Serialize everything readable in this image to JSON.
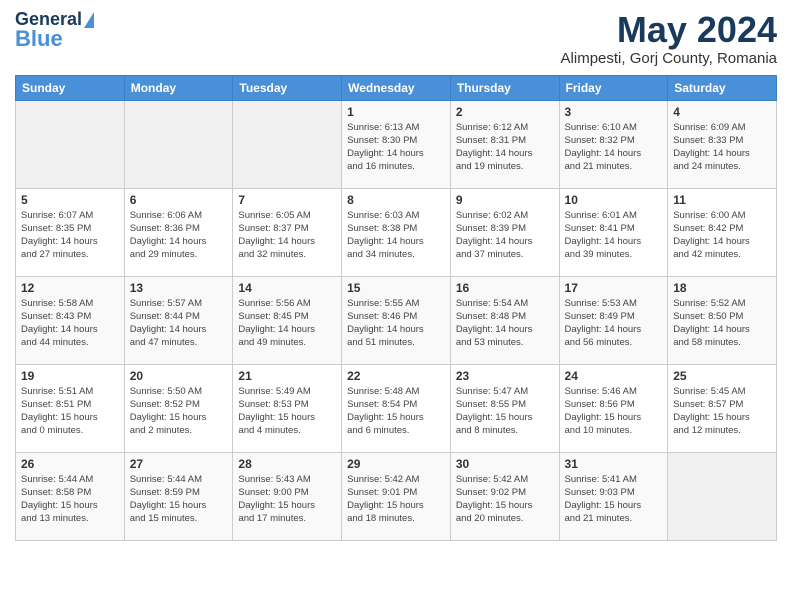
{
  "logo": {
    "line1": "General",
    "line2": "Blue"
  },
  "title": "May 2024",
  "location": "Alimpesti, Gorj County, Romania",
  "days_of_week": [
    "Sunday",
    "Monday",
    "Tuesday",
    "Wednesday",
    "Thursday",
    "Friday",
    "Saturday"
  ],
  "weeks": [
    [
      {
        "day": "",
        "info": ""
      },
      {
        "day": "",
        "info": ""
      },
      {
        "day": "",
        "info": ""
      },
      {
        "day": "1",
        "info": "Sunrise: 6:13 AM\nSunset: 8:30 PM\nDaylight: 14 hours\nand 16 minutes."
      },
      {
        "day": "2",
        "info": "Sunrise: 6:12 AM\nSunset: 8:31 PM\nDaylight: 14 hours\nand 19 minutes."
      },
      {
        "day": "3",
        "info": "Sunrise: 6:10 AM\nSunset: 8:32 PM\nDaylight: 14 hours\nand 21 minutes."
      },
      {
        "day": "4",
        "info": "Sunrise: 6:09 AM\nSunset: 8:33 PM\nDaylight: 14 hours\nand 24 minutes."
      }
    ],
    [
      {
        "day": "5",
        "info": "Sunrise: 6:07 AM\nSunset: 8:35 PM\nDaylight: 14 hours\nand 27 minutes."
      },
      {
        "day": "6",
        "info": "Sunrise: 6:06 AM\nSunset: 8:36 PM\nDaylight: 14 hours\nand 29 minutes."
      },
      {
        "day": "7",
        "info": "Sunrise: 6:05 AM\nSunset: 8:37 PM\nDaylight: 14 hours\nand 32 minutes."
      },
      {
        "day": "8",
        "info": "Sunrise: 6:03 AM\nSunset: 8:38 PM\nDaylight: 14 hours\nand 34 minutes."
      },
      {
        "day": "9",
        "info": "Sunrise: 6:02 AM\nSunset: 8:39 PM\nDaylight: 14 hours\nand 37 minutes."
      },
      {
        "day": "10",
        "info": "Sunrise: 6:01 AM\nSunset: 8:41 PM\nDaylight: 14 hours\nand 39 minutes."
      },
      {
        "day": "11",
        "info": "Sunrise: 6:00 AM\nSunset: 8:42 PM\nDaylight: 14 hours\nand 42 minutes."
      }
    ],
    [
      {
        "day": "12",
        "info": "Sunrise: 5:58 AM\nSunset: 8:43 PM\nDaylight: 14 hours\nand 44 minutes."
      },
      {
        "day": "13",
        "info": "Sunrise: 5:57 AM\nSunset: 8:44 PM\nDaylight: 14 hours\nand 47 minutes."
      },
      {
        "day": "14",
        "info": "Sunrise: 5:56 AM\nSunset: 8:45 PM\nDaylight: 14 hours\nand 49 minutes."
      },
      {
        "day": "15",
        "info": "Sunrise: 5:55 AM\nSunset: 8:46 PM\nDaylight: 14 hours\nand 51 minutes."
      },
      {
        "day": "16",
        "info": "Sunrise: 5:54 AM\nSunset: 8:48 PM\nDaylight: 14 hours\nand 53 minutes."
      },
      {
        "day": "17",
        "info": "Sunrise: 5:53 AM\nSunset: 8:49 PM\nDaylight: 14 hours\nand 56 minutes."
      },
      {
        "day": "18",
        "info": "Sunrise: 5:52 AM\nSunset: 8:50 PM\nDaylight: 14 hours\nand 58 minutes."
      }
    ],
    [
      {
        "day": "19",
        "info": "Sunrise: 5:51 AM\nSunset: 8:51 PM\nDaylight: 15 hours\nand 0 minutes."
      },
      {
        "day": "20",
        "info": "Sunrise: 5:50 AM\nSunset: 8:52 PM\nDaylight: 15 hours\nand 2 minutes."
      },
      {
        "day": "21",
        "info": "Sunrise: 5:49 AM\nSunset: 8:53 PM\nDaylight: 15 hours\nand 4 minutes."
      },
      {
        "day": "22",
        "info": "Sunrise: 5:48 AM\nSunset: 8:54 PM\nDaylight: 15 hours\nand 6 minutes."
      },
      {
        "day": "23",
        "info": "Sunrise: 5:47 AM\nSunset: 8:55 PM\nDaylight: 15 hours\nand 8 minutes."
      },
      {
        "day": "24",
        "info": "Sunrise: 5:46 AM\nSunset: 8:56 PM\nDaylight: 15 hours\nand 10 minutes."
      },
      {
        "day": "25",
        "info": "Sunrise: 5:45 AM\nSunset: 8:57 PM\nDaylight: 15 hours\nand 12 minutes."
      }
    ],
    [
      {
        "day": "26",
        "info": "Sunrise: 5:44 AM\nSunset: 8:58 PM\nDaylight: 15 hours\nand 13 minutes."
      },
      {
        "day": "27",
        "info": "Sunrise: 5:44 AM\nSunset: 8:59 PM\nDaylight: 15 hours\nand 15 minutes."
      },
      {
        "day": "28",
        "info": "Sunrise: 5:43 AM\nSunset: 9:00 PM\nDaylight: 15 hours\nand 17 minutes."
      },
      {
        "day": "29",
        "info": "Sunrise: 5:42 AM\nSunset: 9:01 PM\nDaylight: 15 hours\nand 18 minutes."
      },
      {
        "day": "30",
        "info": "Sunrise: 5:42 AM\nSunset: 9:02 PM\nDaylight: 15 hours\nand 20 minutes."
      },
      {
        "day": "31",
        "info": "Sunrise: 5:41 AM\nSunset: 9:03 PM\nDaylight: 15 hours\nand 21 minutes."
      },
      {
        "day": "",
        "info": ""
      }
    ]
  ]
}
